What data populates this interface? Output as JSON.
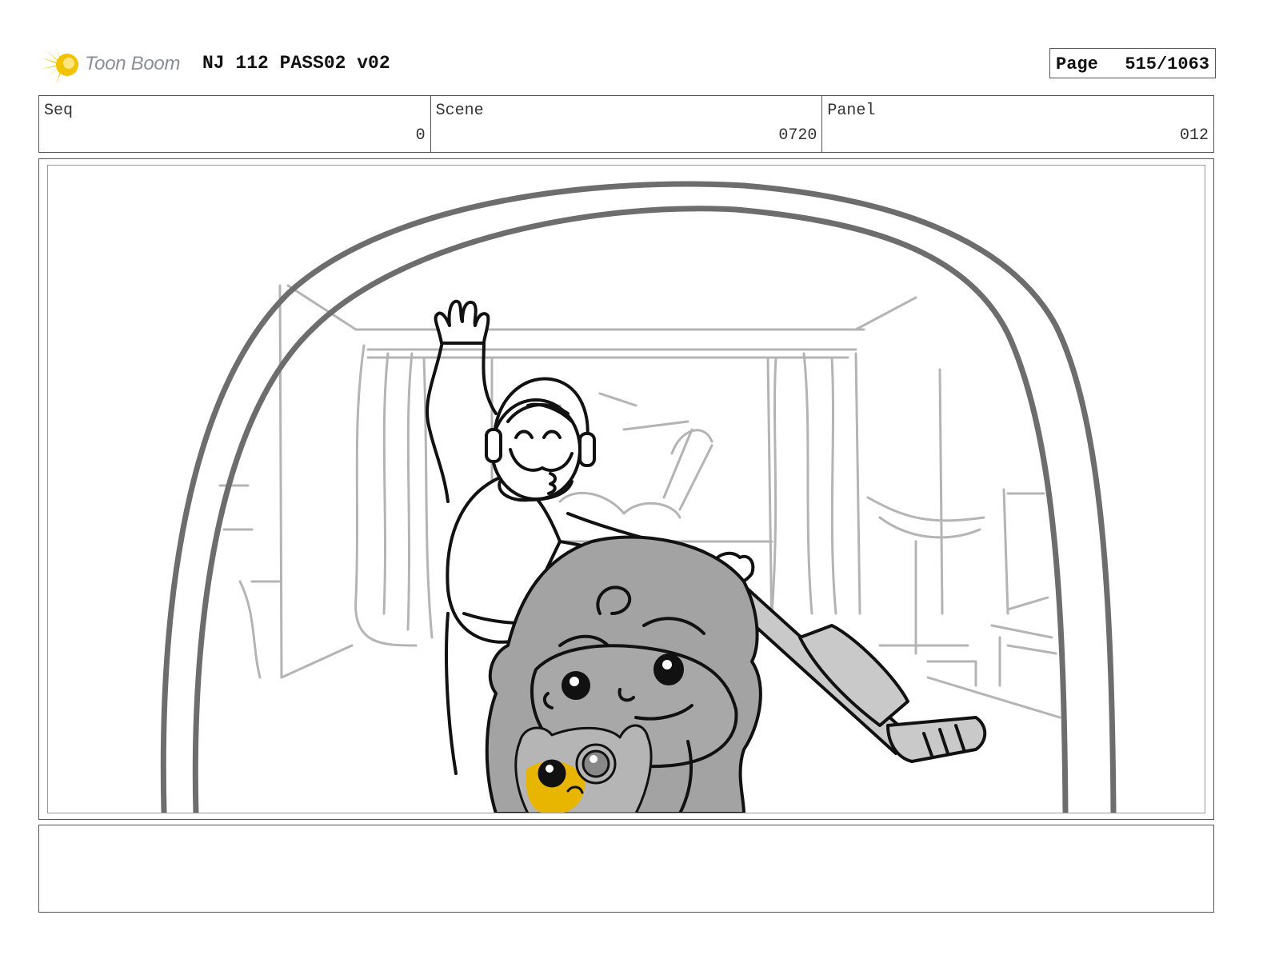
{
  "header": {
    "logo_text": "Toon Boom",
    "title": "NJ 112 PASS02 v02",
    "page_label": "Page",
    "page_value": "515/1063"
  },
  "info": {
    "seq_label": "Seq",
    "seq_value": "0",
    "scene_label": "Scene",
    "scene_value": "0720",
    "panel_label": "Panel",
    "panel_value": "012"
  },
  "caption": {
    "text": ""
  },
  "colors": {
    "logo_yellow": "#f2c300",
    "sketch_dark": "#111111",
    "sketch_gray": "#a8a8a8",
    "fill_gray": "#9d9d9d",
    "accent_yellow": "#e8b600"
  }
}
